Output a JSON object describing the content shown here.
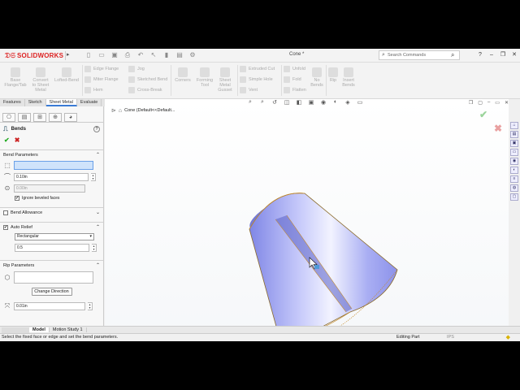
{
  "app": {
    "brand": "SOLIDWORKS",
    "document_title": "Cone *",
    "search_placeholder": "Search Commands"
  },
  "command_manager": {
    "large": [
      {
        "label": "Base\nFlange/Tab"
      },
      {
        "label": "Convert\nto Sheet\nMetal"
      },
      {
        "label": "Lofted-Bend"
      },
      {
        "label": "Corners"
      },
      {
        "label": "Forming\nTool"
      },
      {
        "label": "Sheet\nMetal\nGusset"
      },
      {
        "label": "No\nBends"
      },
      {
        "label": "Rip"
      },
      {
        "label": "Insert\nBends"
      }
    ],
    "small": [
      {
        "label": "Edge Flange"
      },
      {
        "label": "Miter Flange"
      },
      {
        "label": "Hem"
      },
      {
        "label": "Jog"
      },
      {
        "label": "Sketched Bend"
      },
      {
        "label": "Cross-Break"
      },
      {
        "label": "Extruded Cut"
      },
      {
        "label": "Simple Hole"
      },
      {
        "label": "Vent"
      },
      {
        "label": "Unfold"
      },
      {
        "label": "Fold"
      },
      {
        "label": "Flatten"
      }
    ]
  },
  "tabs": [
    "Features",
    "Sketch",
    "Sheet Metal",
    "Evaluate"
  ],
  "property_manager": {
    "title": "Bends",
    "help": "?",
    "ok": "✔",
    "cancel": "✖",
    "bend_parameters": {
      "header": "Bend Parameters",
      "radius": "0.10in",
      "thickness": "0.00in",
      "ignore_beveled_label": "Ignore beveled faces",
      "ignore_beveled_checked": "✔"
    },
    "bend_allowance": {
      "header": "Bend Allowance"
    },
    "auto_relief": {
      "header": "Auto Relief",
      "checked": "✔",
      "type": "Rectangular",
      "ratio": "0.5"
    },
    "rip_parameters": {
      "header": "Rip Parameters",
      "change_direction": "Change Direction",
      "gap": "0.01in"
    }
  },
  "viewport": {
    "tree_label": "Cone  (Default<<Default..."
  },
  "bottom_tabs": [
    "Model",
    "Motion Study 1"
  ],
  "status": {
    "message": "Select the fixed face or edge and set the bend parameters.",
    "mode": "Editing Part",
    "units": "IPS"
  },
  "colors": {
    "accent": "#3a7bd5",
    "brand": "#dd2222",
    "part_surface": "#9b9ff2",
    "part_edge": "#c58a2a"
  }
}
